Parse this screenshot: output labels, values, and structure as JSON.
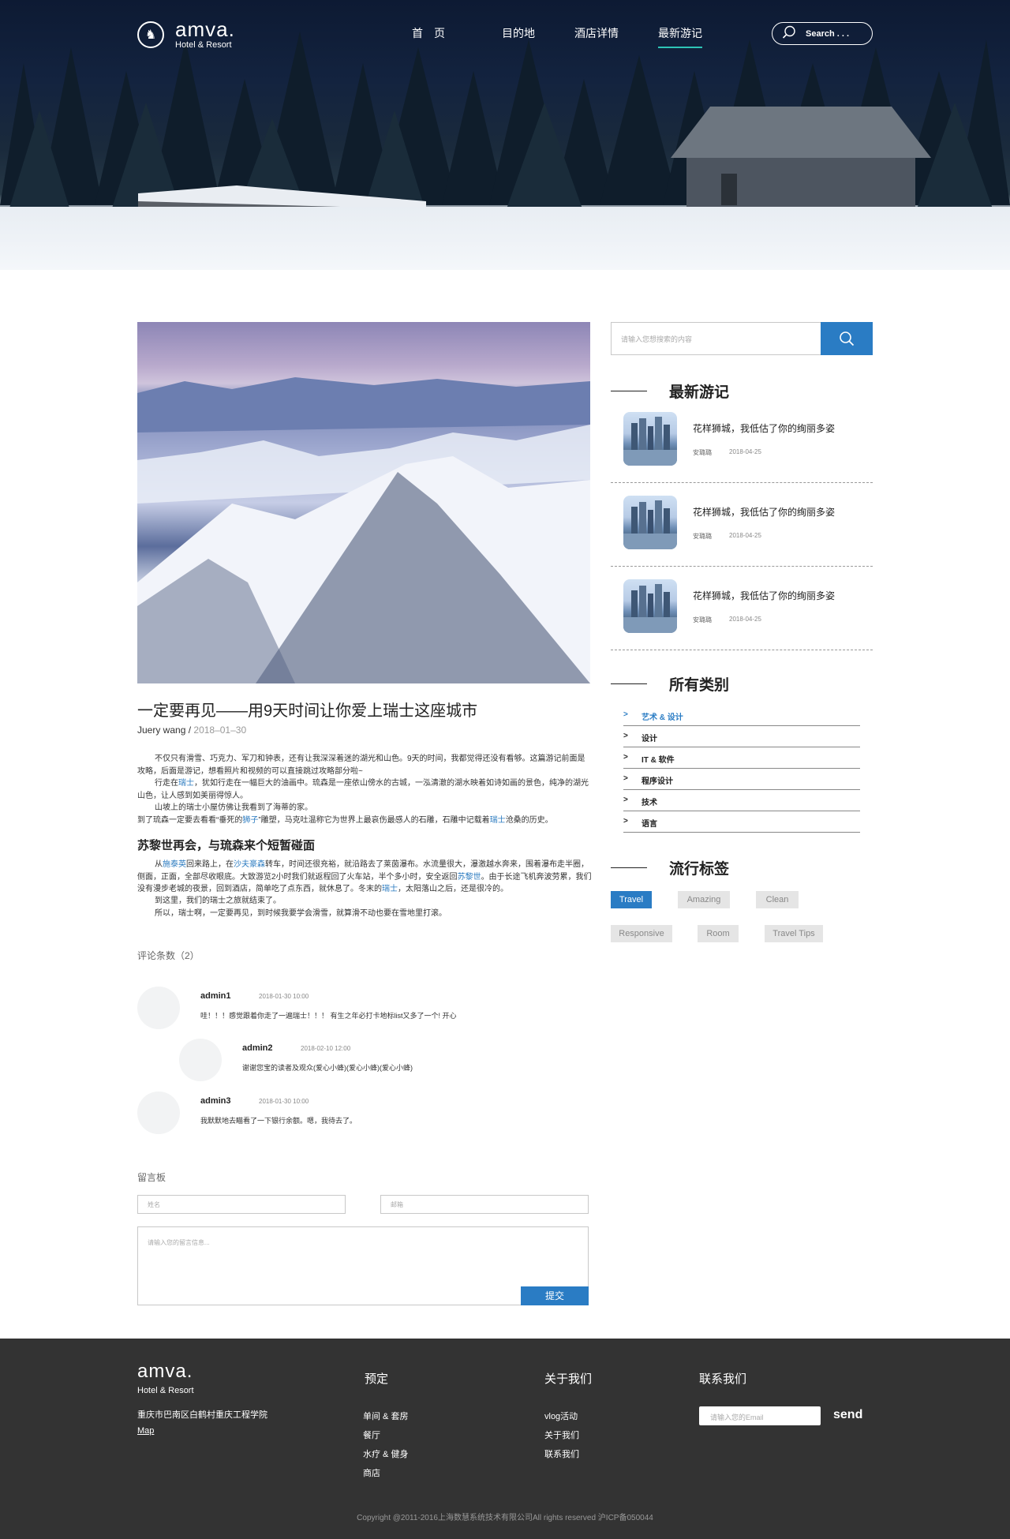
{
  "header": {
    "brand": "amva.",
    "brand_sub": "Hotel & Resort",
    "nav": [
      "首　页",
      "目的地",
      "酒店详情",
      "最新游记"
    ],
    "search_label": "Search . . ."
  },
  "article": {
    "title": "一定要再见——用9天时间让你爱上瑞士这座城市",
    "author": "Juery wang",
    "date": "2018–01–30",
    "p1": "不仅只有滑雪、巧克力、军刀和钟表，还有让我深深着迷的湖光和山色。9天的时间，我都觉得还没有看够。这篇游记前面是攻略，后面是游记，想看照片和视频的可以直接跳过攻略部分啦~",
    "p2a": "行走在",
    "p2_link": "瑞士",
    "p2b": "，犹如行走在一幅巨大的油画中。琉森是一座依山傍水的古城，一泓清澈的湖水映着如诗如画的景色，纯净的湖光山色，让人感到如美丽得惊人。",
    "p3": "山坡上的瑞士小屋仿佛让我看到了海蒂的家。",
    "p4a": "到了琉森一定要去看看“垂死的",
    "p4_link": "狮子",
    "p4b": "”雕塑，马克吐温称它为世界上最哀伤最感人的石雕，石雕中记载着",
    "p4_link2": "瑞士",
    "p4c": "沧桑的历史。",
    "subheading": "苏黎世再会，与琉森来个短暂碰面",
    "p5a": "从",
    "p5_link1": "施泰英",
    "p5b": "回来路上，在",
    "p5_link2": "沙夫豪森",
    "p5c": "转车，时间还很充裕，就沿路去了莱茵瀑布。水流量很大，瀑激越水奔来，围着瀑布走半圈，侧面，正面，全部尽收眼底。大致游览2小时我们就返程回了火车站，半个多小时，安全返回",
    "p5_link3": "苏黎世",
    "p5d": "。由于长途飞机奔波劳累，我们没有漫步老城的夜景，回到酒店，简单吃了点东西，就休息了。冬末的",
    "p5_link4": "瑞士",
    "p5e": "，太阳落山之后，还是很冷的。",
    "p6": "到这里，我们的瑞士之旅就结束了。",
    "p7": "所以，瑞士啊，一定要再见，到时候我要学会滑雪，就算滑不动也要在雪地里打滚。"
  },
  "comments": {
    "count_label": "评论条数（2）",
    "items": [
      {
        "name": "admin1",
        "date": "2018-01-30  10:00",
        "text": "哇！！！感觉跟着你走了一遍瑞士！！！ 有生之年必打卡地标list又多了一个! 开心"
      },
      {
        "name": "admin2",
        "date": "2018-02-10  12:00",
        "text": "谢谢您宝的读者及观众(爱心小蜂)(爱心小蜂)(爱心小蜂)"
      },
      {
        "name": "admin3",
        "date": "2018-01-30  10:00",
        "text": "我默默地去瞄看了一下银行余额。嗯，我待去了。"
      }
    ]
  },
  "board": {
    "title": "留言板",
    "name_placeholder": "姓名",
    "email_placeholder": "邮箱",
    "message_placeholder": "请输入您的留言信息...",
    "submit": "提交"
  },
  "sidebar": {
    "search_placeholder": "请输入您想搜索的内容",
    "latest_title": "最新游记",
    "posts": [
      {
        "title": "花样狮城，我低估了你的绚丽多姿",
        "author": "安璐璐",
        "date": "2018-04-25"
      },
      {
        "title": "花样狮城，我低估了你的绚丽多姿",
        "author": "安璐璐",
        "date": "2018-04-25"
      },
      {
        "title": "花样狮城，我低估了你的绚丽多姿",
        "author": "安璐璐",
        "date": "2018-04-25"
      }
    ],
    "categories_title": "所有类别",
    "categories": [
      "艺术 & 设计",
      "设计",
      "IT & 软件",
      "程序设计",
      "技术",
      "语言"
    ],
    "tags_title": "流行标签",
    "tags": [
      "Travel",
      "Amazing",
      "Clean",
      "Responsive",
      "Room",
      "Travel Tips"
    ]
  },
  "footer": {
    "brand": "amva.",
    "brand_sub": "Hotel & Resort",
    "address": "重庆市巴南区白鹤村重庆工程学院",
    "map": "Map",
    "col1_title": "预定",
    "col1_links": [
      "单间 & 套房",
      "餐厅",
      "水疗 & 健身",
      "商店"
    ],
    "col2_title": "关于我们",
    "col2_links": [
      "vlog活动",
      "关于我们",
      "联系我们"
    ],
    "col3_title": "联系我们",
    "email_placeholder": "请输入您的Email",
    "send": "send",
    "copyright": "Copyright @2011-2016上海数慧系统技术有限公司All rights reserved 沪ICP备050044"
  },
  "colors": {
    "accent": "#2a7cc4",
    "nav_underline": "#2ec4b6",
    "footer_bg": "#333333"
  }
}
